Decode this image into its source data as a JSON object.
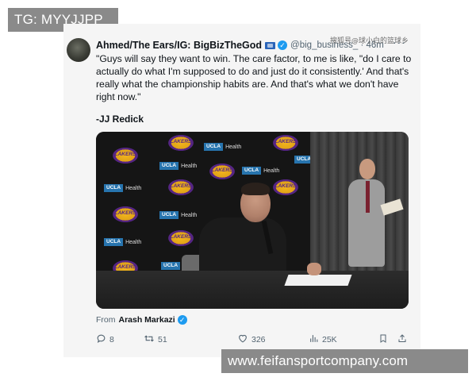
{
  "overlay": {
    "tg_label": "TG: MYYJJPP",
    "site_label": "www.feifansportcompany.com",
    "cn_watermark": "搜狐号@球小白的篮球乡"
  },
  "tweet": {
    "author": "Ahmed/The Ears/IG: BigBizTheGod",
    "handle": "@big_business_ · 46m",
    "quote": "\"Guys will say they want to win. The care factor, to me is like, \"do I care to actually do what I'm supposed to do and just do it consistently.' And that's really what the championship habits are. And that's what we don't have right now.\"",
    "signature": "-JJ Redick",
    "media": {
      "lakers_logo_text": "LAKERS",
      "ucla_text": "UCLA",
      "health_text": "Health"
    },
    "from_prefix": "From",
    "from_name": "Arash Markazi",
    "actions": {
      "replies": "8",
      "reposts": "51",
      "likes": "326",
      "views": "25K"
    }
  },
  "icons": {
    "verified": "verified-badge-icon",
    "reply": "reply-icon",
    "repost": "repost-icon",
    "like": "heart-icon",
    "views": "analytics-icon",
    "bookmark": "bookmark-icon",
    "share": "share-icon"
  },
  "colors": {
    "verified_blue": "#1d9bf0",
    "secondary_text": "#536471",
    "overlay_gray": "#8a8a8a",
    "lakers_gold": "#f2b51e",
    "lakers_purple": "#552583",
    "ucla_blue": "#2774ae"
  }
}
